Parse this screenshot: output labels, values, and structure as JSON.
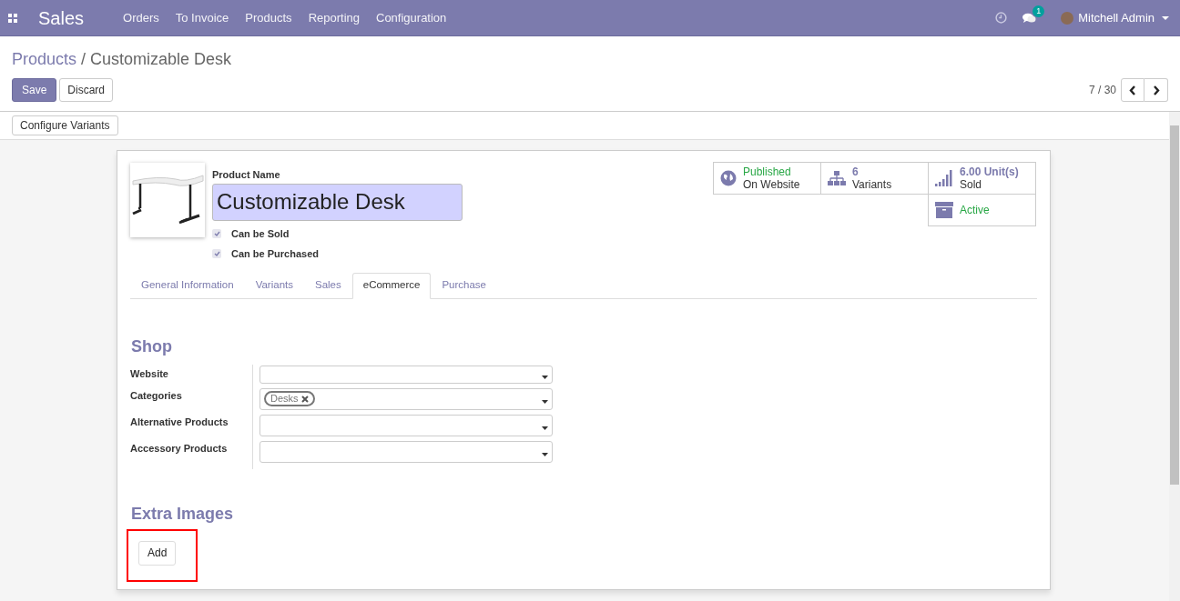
{
  "navbar": {
    "app_title": "Sales",
    "menu": [
      "Orders",
      "To Invoice",
      "Products",
      "Reporting",
      "Configuration"
    ],
    "messages_count": "1",
    "user": "Mitchell Admin"
  },
  "breadcrumb_separator": "/",
  "breadcrumb": [
    {
      "label": "Products",
      "link": true
    },
    {
      "label": "Customizable Desk",
      "link": false
    }
  ],
  "actions": {
    "save": "Save",
    "discard": "Discard",
    "pager": "7 / 30"
  },
  "toolbar_button": "Configure Variants",
  "product": {
    "name_label": "Product Name",
    "name": "Customizable Desk",
    "checkboxes": [
      {
        "label": "Can be Sold",
        "checked": true
      },
      {
        "label": "Can be Purchased",
        "checked": true
      }
    ]
  },
  "smart_buttons": [
    {
      "kind": "website",
      "line1": "Published",
      "line2": "On Website"
    },
    {
      "kind": "variants",
      "line1": "6",
      "line2": "Variants"
    },
    {
      "kind": "sold",
      "line1": "6.00 Unit(s)",
      "line2": "Sold"
    },
    {
      "kind": "active",
      "line1": "Active"
    }
  ],
  "tabs": [
    {
      "label": "General Information",
      "selected": false
    },
    {
      "label": "Variants",
      "selected": false
    },
    {
      "label": "Sales",
      "selected": false
    },
    {
      "label": "eCommerce",
      "selected": true
    },
    {
      "label": "Purchase",
      "selected": false
    }
  ],
  "shop": {
    "title": "Shop",
    "fields": [
      {
        "label": "Website"
      },
      {
        "label": "Categories",
        "tags": [
          "Desks"
        ]
      },
      {
        "label": "Alternative Products"
      },
      {
        "label": "Accessory Products"
      }
    ]
  },
  "extra_images": {
    "title": "Extra Images",
    "add_button": "Add",
    "highlighted": true
  }
}
